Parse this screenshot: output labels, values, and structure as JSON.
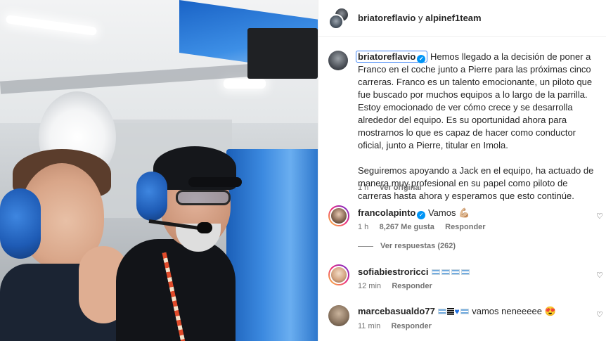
{
  "header": {
    "user_primary": "briatoreflavio",
    "joiner": "y",
    "user_secondary": "alpinef1team"
  },
  "caption": {
    "username": "briatoreflavio",
    "paragraph1": "Hemos llegado a la decisión de poner a Franco en el coche junto a Pierre para las próximas cinco carreras. Franco es un talento emocionante, un piloto que fue buscado por muchos equipos a lo largo de la parrilla. Estoy emocionado de ver cómo crece y se desarrolla alrededor del equipo. Es su oportunidad ahora para mostrarnos lo que es capaz de hacer como conductor oficial, junto a Pierre, titular en Imola.",
    "paragraph2": "Seguiremos apoyando a Jack en el equipo, ha actuado de manera muy profesional en su papel como piloto de carreras hasta ahora y esperamos que esto continúe.",
    "time": "1 h",
    "see_translation": "Ver original"
  },
  "comments": [
    {
      "username": "francolapinto",
      "text": "Vamos 💪🏼",
      "time": "1 h",
      "likes": "8,267 Me gusta",
      "reply": "Responder"
    },
    {
      "username": "sofiabiestroricci",
      "time": "12 min",
      "reply": "Responder"
    },
    {
      "username": "marcebasualdo77",
      "text": "vamos neneeeee 😍",
      "time": "11 min",
      "reply": "Responder"
    }
  ],
  "view_replies": "Ver respuestas (262)",
  "icons": {
    "verified": "verified-badge-icon",
    "like": "heart-outline-icon"
  },
  "colors": {
    "verified_blue": "#0095f6",
    "text_primary": "#262626",
    "text_secondary": "#737373",
    "alpine_blue": "#1a63c6"
  }
}
